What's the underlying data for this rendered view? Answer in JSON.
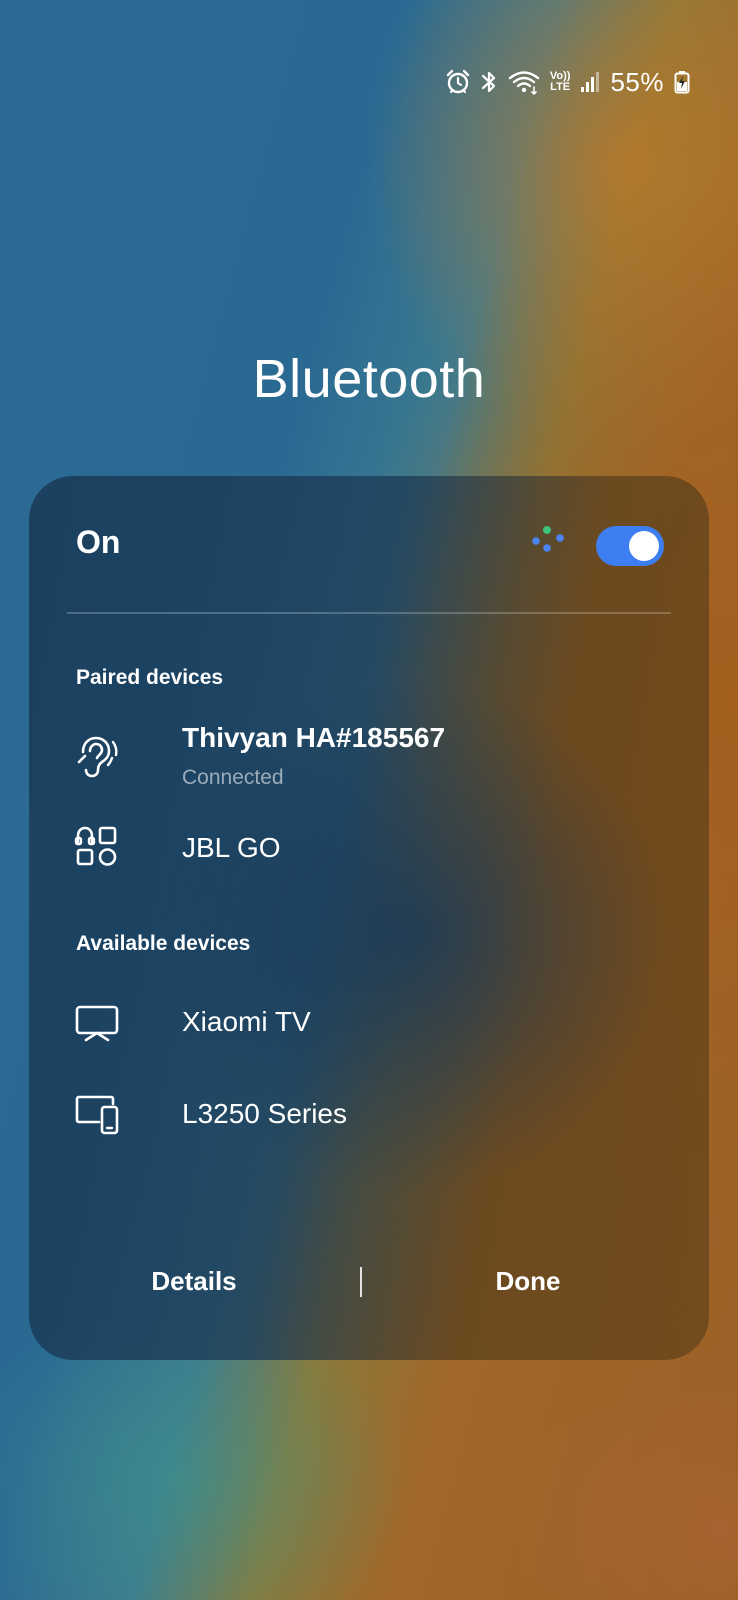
{
  "status_bar": {
    "icons": [
      "alarm-icon",
      "bluetooth-icon",
      "wifi-icon",
      "volte-icon",
      "signal-icon",
      "battery-charging-icon"
    ],
    "volte_top": "Vo))",
    "volte_bottom": "LTE",
    "battery_text": "55%"
  },
  "dialog": {
    "title": "Bluetooth",
    "toggle": {
      "label": "On",
      "state": true,
      "accent_color": "#3d7ff2"
    },
    "sections": {
      "paired": {
        "header": "Paired devices",
        "devices": [
          {
            "name": "Thivyan HA#185567",
            "status": "Connected",
            "icon": "hearing-aid-icon"
          },
          {
            "name": "JBL GO",
            "icon": "audio-device-icon"
          }
        ]
      },
      "available": {
        "header": "Available devices",
        "devices": [
          {
            "name": "Xiaomi TV",
            "icon": "tv-icon"
          },
          {
            "name": "L3250 Series",
            "icon": "devices-icon"
          }
        ]
      }
    },
    "buttons": {
      "details": "Details",
      "done": "Done"
    }
  }
}
